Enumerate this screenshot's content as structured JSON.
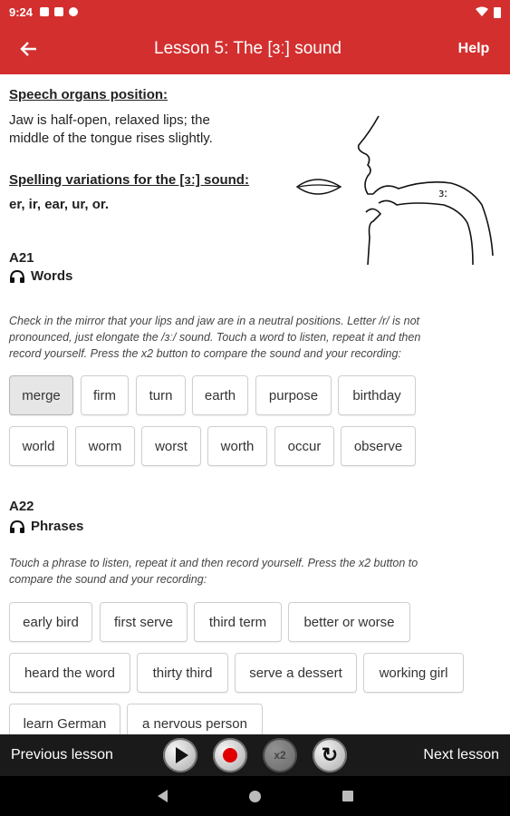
{
  "status": {
    "time": "9:24"
  },
  "appbar": {
    "title": "Lesson 5: The [ɜː] sound",
    "help": "Help"
  },
  "speech": {
    "heading": "Speech organs position:",
    "text_line1": "Jaw is half-open, relaxed lips; the",
    "text_line2": "middle of the tongue rises slightly.",
    "spelling_heading": "Spelling variations for the [ɜː] sound:",
    "spelling": "er, ir, ear, ur, or.",
    "diagram_label": "ɜː"
  },
  "a21": {
    "code": "A21",
    "title": "Words",
    "instr_l1": "Check in the mirror that your lips and jaw are in a neutral positions. Letter /r/ is not",
    "instr_l2": "pronounced, just elongate the /ɜː/ sound. Touch a word to listen, repeat it and then",
    "instr_l3": "record yourself. Press the x2 button to compare the sound and your recording:",
    "words": [
      "merge",
      "firm",
      "turn",
      "earth",
      "purpose",
      "birthday",
      "world",
      "worm",
      "worst",
      "worth",
      "occur",
      "observe"
    ]
  },
  "a22": {
    "code": "A22",
    "title": "Phrases",
    "instr_l1": "Touch a phrase to listen, repeat it and then record yourself. Press the x2 button to",
    "instr_l2": "compare the sound and your recording:",
    "phrases": [
      "early bird",
      "first serve",
      "third term",
      "better or worse",
      "heard the word",
      "thirty third",
      "serve a dessert",
      "working girl",
      "learn German",
      "a nervous person"
    ]
  },
  "bottom": {
    "prev": "Previous lesson",
    "next": "Next lesson",
    "x2": "x2"
  }
}
